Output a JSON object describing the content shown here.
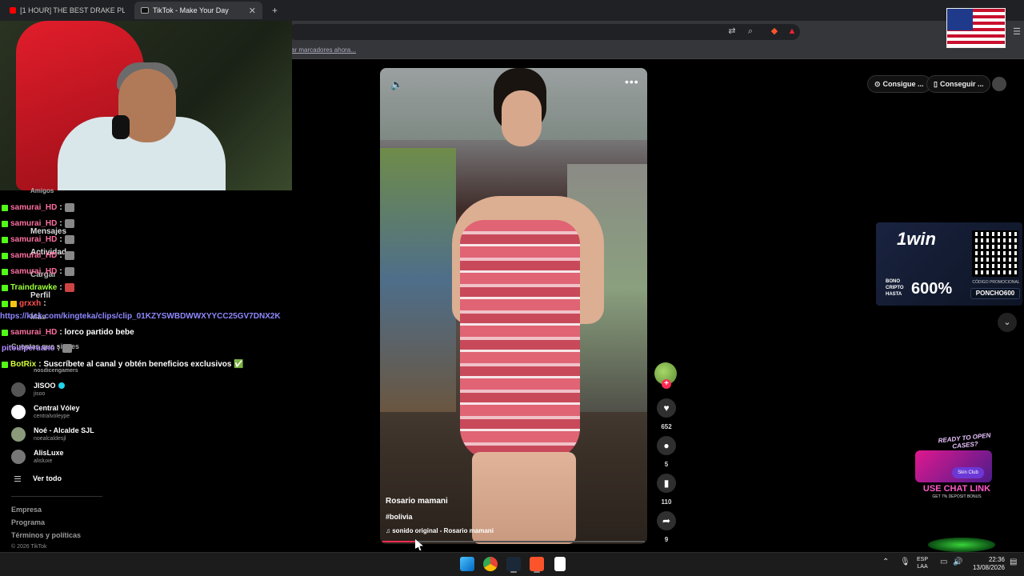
{
  "browser": {
    "tabs": [
      {
        "title": "[1 HOUR] THE BEST DRAKE PLAYLIST",
        "active": false
      },
      {
        "title": "TikTok - Make Your Day",
        "active": true
      }
    ],
    "new_tab": "+",
    "bookmarks_hint": "ar marcadores ahora..."
  },
  "chat": {
    "messages": [
      {
        "user": "samurai_HD",
        "text": ":"
      },
      {
        "user": "samurai_HD",
        "text": ":"
      },
      {
        "user": "samurai_HD",
        "text": ":"
      },
      {
        "user": "samurai_HD",
        "text": ":"
      },
      {
        "user": "samurai_HD",
        "text": ":"
      },
      {
        "user": "Traindrawke",
        "text": ":"
      },
      {
        "user": "grxxh",
        "text": ":"
      },
      {
        "user": "samurai_HD",
        "text": ": lorco partido bebe"
      },
      {
        "user": "pitoulperuano",
        "text": ":"
      },
      {
        "user": "BotRix",
        "text": ": Suscríbete al canal y obtén beneficios exclusivos ✅"
      }
    ],
    "link": "https://kick.com/kingteka/clips/clip_01KZYSWBDWWXYYCC25GV7DNX2K",
    "nav_ghosts": [
      "Amigos",
      "Mensajes",
      "Actividad",
      "Cargar",
      "Perfil",
      "Más",
      "Cuentas que sigues"
    ]
  },
  "following": {
    "accounts": [
      {
        "name": "JISOO",
        "handle": "jisoo",
        "verified": true
      },
      {
        "name": "Central Vóley",
        "handle": "centralvoleype",
        "verified": false
      },
      {
        "name": "Noé - Alcalde SJL",
        "handle": "noealcaldesjl",
        "verified": false
      },
      {
        "name": "AlisLuxe",
        "handle": "alisluxe",
        "verified": false
      }
    ],
    "partial_handle": "nosdicengamers",
    "see_all": "Ver todo"
  },
  "footer": {
    "links": [
      "Empresa",
      "Programa",
      "Términos y políticas"
    ],
    "copyright": "© 2026 TikTok"
  },
  "video": {
    "author": "Rosario mamani",
    "hashtag": "#bolivia",
    "sound": "sonido original - Rosario mamani",
    "progress": 0.13,
    "likes": "652",
    "comments": "5",
    "saves": "110",
    "shares": "9"
  },
  "top_actions": {
    "coins": "Consigue ...",
    "app": "Conseguir ..."
  },
  "ad": {
    "brand": "1win",
    "bono": "BONO CRIPTO HASTA",
    "percent": "600%",
    "promo_label": "CÓDIGO PROMOCIONAL",
    "code": "PONCHO600"
  },
  "cases": {
    "headline": "READY TO OPEN CASES?",
    "skin": "Skin Club",
    "cta": "USE CHAT LINK",
    "sub": "GET 7% DEPOSIT BONUS"
  },
  "taskbar": {
    "lang_top": "ESP",
    "lang_bottom": "LAA",
    "time": "22:36",
    "date": "13/08/2026"
  },
  "colors": {
    "tiktok_red": "#fe2c55",
    "kick_green": "#53fc18",
    "link_purple": "#8e88ff"
  }
}
